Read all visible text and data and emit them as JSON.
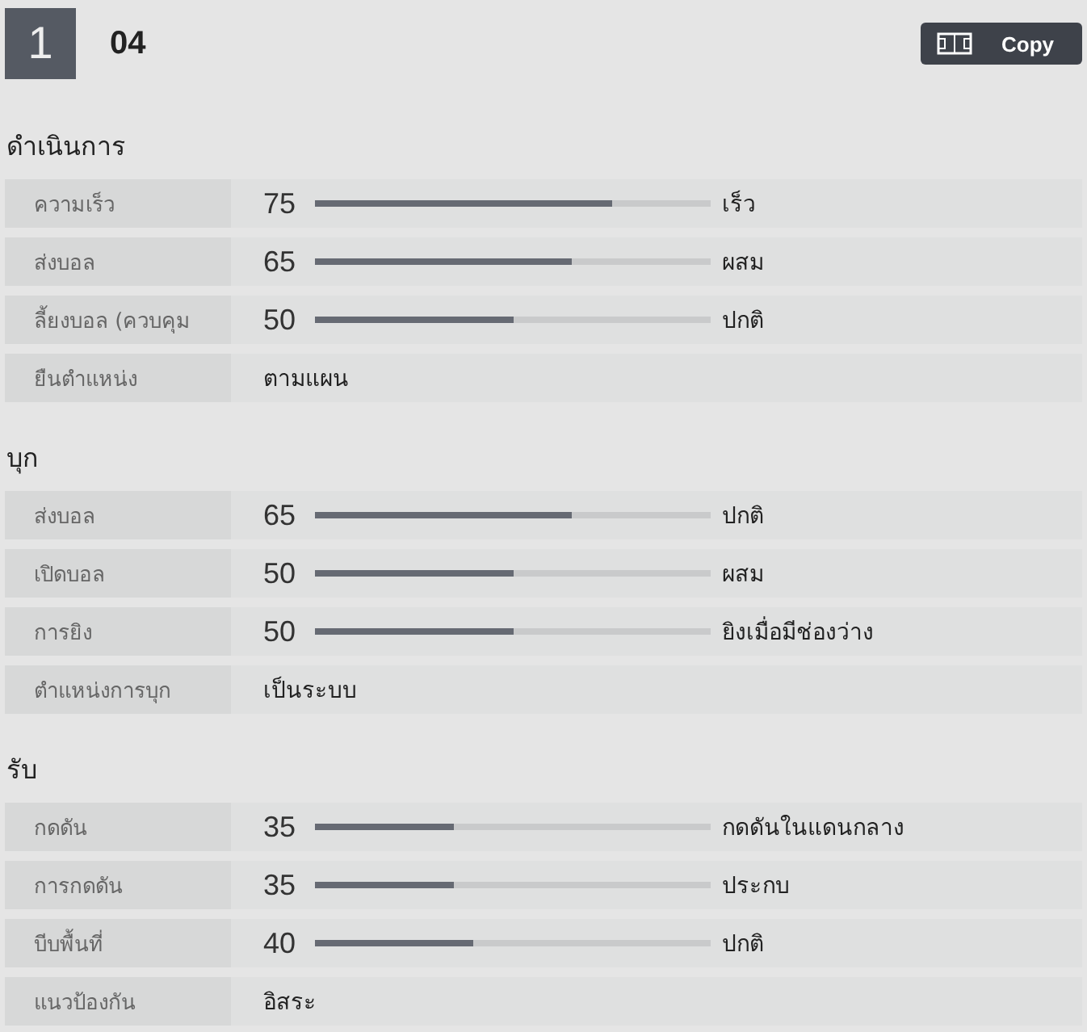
{
  "header": {
    "number": "1",
    "title": "04",
    "copy_button": "Copy"
  },
  "sections": [
    {
      "title": "ดำเนินการ",
      "rows": [
        {
          "kind": "slider",
          "label": "ความเร็ว",
          "value": "75",
          "level": 0.75,
          "setting": "เร็ว"
        },
        {
          "kind": "slider",
          "label": "ส่งบอล",
          "value": "65",
          "level": 0.65,
          "setting": "ผสม"
        },
        {
          "kind": "slider",
          "label": "ลี้ยงบอล (ควบคุม",
          "value": "50",
          "level": 0.5,
          "setting": "ปกติ"
        },
        {
          "kind": "text",
          "label": "ยืนตำแหน่ง",
          "setting": "ตามแผน"
        }
      ]
    },
    {
      "title": "บุก",
      "rows": [
        {
          "kind": "slider",
          "label": "ส่งบอล",
          "value": "65",
          "level": 0.65,
          "setting": "ปกติ"
        },
        {
          "kind": "slider",
          "label": "เปิดบอล",
          "value": "50",
          "level": 0.5,
          "setting": "ผสม"
        },
        {
          "kind": "slider",
          "label": "การยิง",
          "value": "50",
          "level": 0.5,
          "setting": "ยิงเมื่อมีช่องว่าง"
        },
        {
          "kind": "text",
          "label": "ตำแหน่งการบุก",
          "setting": "เป็นระบบ"
        }
      ]
    },
    {
      "title": "รับ",
      "rows": [
        {
          "kind": "slider",
          "label": "กดดัน",
          "value": "35",
          "level": 0.35,
          "setting": "กดดันในแดนกลาง"
        },
        {
          "kind": "slider",
          "label": "การกดดัน",
          "value": "35",
          "level": 0.35,
          "setting": "ประกบ"
        },
        {
          "kind": "slider",
          "label": "บีบพื้นที่",
          "value": "40",
          "level": 0.4,
          "setting": "ปกติ"
        },
        {
          "kind": "text",
          "label": "แนวป้องกัน",
          "setting": "อิสระ"
        }
      ]
    }
  ]
}
